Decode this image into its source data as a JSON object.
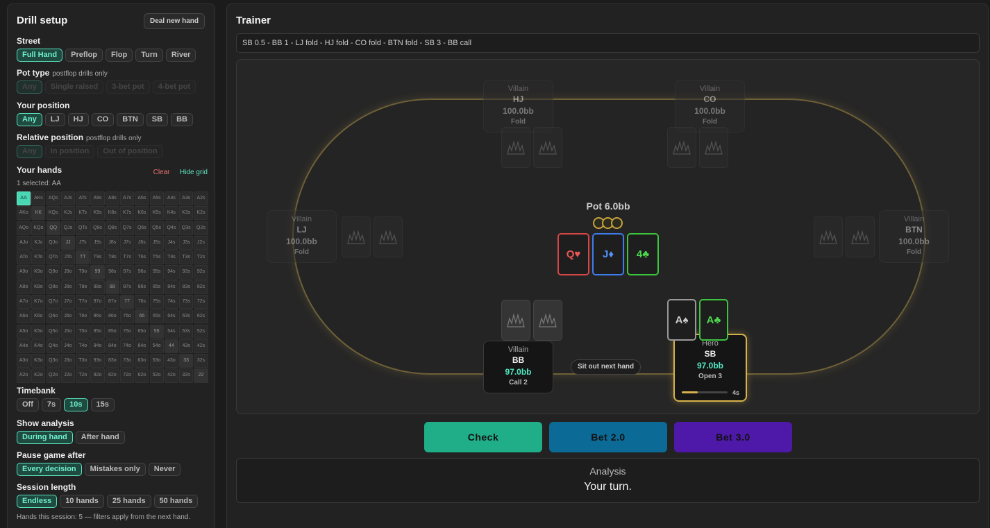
{
  "sidebar": {
    "title": "Drill setup",
    "deal_button": "Deal new hand",
    "street": {
      "label": "Street",
      "options": [
        "Full Hand",
        "Preflop",
        "Flop",
        "Turn",
        "River"
      ],
      "selected": "Full Hand"
    },
    "pot_type": {
      "label": "Pot type",
      "note": "postflop drills only",
      "options": [
        "Any",
        "Single raised",
        "3-bet pot",
        "4-bet pot"
      ],
      "selected": "Any"
    },
    "your_position": {
      "label": "Your position",
      "options": [
        "Any",
        "LJ",
        "HJ",
        "CO",
        "BTN",
        "SB",
        "BB"
      ],
      "selected": "Any"
    },
    "relative_position": {
      "label": "Relative position",
      "note": "postflop drills only",
      "options": [
        "Any",
        "In position",
        "Out of position"
      ],
      "selected": "Any"
    },
    "hands": {
      "label": "Your hands",
      "clear": "Clear",
      "hide_grid": "Hide grid",
      "selected_note": "1 selected: AA",
      "grid": [
        [
          "AA",
          "AKs",
          "AQs",
          "AJs",
          "ATs",
          "A9s",
          "A8s",
          "A7s",
          "A6s",
          "A5s",
          "A4s",
          "A3s",
          "A2s"
        ],
        [
          "AKo",
          "KK",
          "KQs",
          "KJs",
          "KTs",
          "K9s",
          "K8s",
          "K7s",
          "K6s",
          "K5s",
          "K4s",
          "K3s",
          "K2s"
        ],
        [
          "AQo",
          "KQo",
          "QQ",
          "QJs",
          "QTs",
          "Q9s",
          "Q8s",
          "Q7s",
          "Q6s",
          "Q5s",
          "Q4s",
          "Q3s",
          "Q2s"
        ],
        [
          "AJo",
          "KJo",
          "QJo",
          "JJ",
          "JTs",
          "J9s",
          "J8s",
          "J7s",
          "J6s",
          "J5s",
          "J4s",
          "J3s",
          "J2s"
        ],
        [
          "ATo",
          "KTo",
          "QTo",
          "JTo",
          "TT",
          "T9s",
          "T8s",
          "T7s",
          "T6s",
          "T5s",
          "T4s",
          "T3s",
          "T2s"
        ],
        [
          "A9o",
          "K9o",
          "Q9o",
          "J9o",
          "T9o",
          "99",
          "98s",
          "97s",
          "96s",
          "95s",
          "94s",
          "93s",
          "92s"
        ],
        [
          "A8o",
          "K8o",
          "Q8o",
          "J8o",
          "T8o",
          "98o",
          "88",
          "87s",
          "86s",
          "85s",
          "84s",
          "83s",
          "82s"
        ],
        [
          "A7o",
          "K7o",
          "Q7o",
          "J7o",
          "T7o",
          "97o",
          "87o",
          "77",
          "76s",
          "75s",
          "74s",
          "73s",
          "72s"
        ],
        [
          "A6o",
          "K6o",
          "Q6o",
          "J6o",
          "T6o",
          "96o",
          "86o",
          "76o",
          "66",
          "65s",
          "64s",
          "63s",
          "62s"
        ],
        [
          "A5o",
          "K5o",
          "Q5o",
          "J5o",
          "T5o",
          "95o",
          "85o",
          "75o",
          "65o",
          "55",
          "54s",
          "53s",
          "52s"
        ],
        [
          "A4o",
          "K4o",
          "Q4o",
          "J4o",
          "T4o",
          "94o",
          "84o",
          "74o",
          "64o",
          "54o",
          "44",
          "43s",
          "42s"
        ],
        [
          "A3o",
          "K3o",
          "Q3o",
          "J3o",
          "T3o",
          "93o",
          "83o",
          "73o",
          "63o",
          "53o",
          "43o",
          "33",
          "32s"
        ],
        [
          "A2o",
          "K2o",
          "Q2o",
          "J2o",
          "T2o",
          "92o",
          "82o",
          "72o",
          "62o",
          "52o",
          "42o",
          "32o",
          "22"
        ]
      ],
      "selected": [
        "AA"
      ]
    },
    "timebank": {
      "label": "Timebank",
      "options": [
        "Off",
        "7s",
        "10s",
        "15s"
      ],
      "selected": "10s"
    },
    "show_analysis": {
      "label": "Show analysis",
      "options": [
        "During hand",
        "After hand"
      ],
      "selected": "During hand"
    },
    "pause_game": {
      "label": "Pause game after",
      "options": [
        "Every decision",
        "Mistakes only",
        "Never"
      ],
      "selected": "Every decision"
    },
    "session_length": {
      "label": "Session length",
      "options": [
        "Endless",
        "10 hands",
        "25 hands",
        "50 hands"
      ],
      "selected": "Endless"
    },
    "session_note": "Hands this session: 5 — filters apply from the next hand."
  },
  "trainer": {
    "title": "Trainer",
    "history": "SB 0.5 - BB 1 - LJ fold - HJ fold - CO fold - BTN fold - SB 3 - BB call",
    "pot": "Pot 6.0bb",
    "board": [
      {
        "rank": "Q",
        "suit": "♥",
        "color": "#ee5555"
      },
      {
        "rank": "J",
        "suit": "♦",
        "color": "#5592ff"
      },
      {
        "rank": "4",
        "suit": "♣",
        "color": "#4dd84d"
      }
    ],
    "hero_cards": [
      {
        "rank": "A",
        "suit": "♠",
        "color": "#cccccc"
      },
      {
        "rank": "A",
        "suit": "♣",
        "color": "#4dd84d"
      }
    ],
    "seats": {
      "hj": {
        "role": "Villain",
        "pos": "HJ",
        "stack": "100.0bb",
        "action": "Fold"
      },
      "co": {
        "role": "Villain",
        "pos": "CO",
        "stack": "100.0bb",
        "action": "Fold"
      },
      "lj": {
        "role": "Villain",
        "pos": "LJ",
        "stack": "100.0bb",
        "action": "Fold"
      },
      "btn": {
        "role": "Villain",
        "pos": "BTN",
        "stack": "100.0bb",
        "action": "Fold"
      },
      "bb": {
        "role": "Villain",
        "pos": "BB",
        "stack": "97.0bb",
        "action": "Call 2"
      },
      "sb": {
        "role": "Hero",
        "pos": "SB",
        "stack": "97.0bb",
        "action": "Open 3",
        "timer": "4s",
        "timer_fraction": 0.35
      }
    },
    "sit_out": "Sit out next hand",
    "actions": {
      "check": "Check",
      "bet_small": "Bet 2.0",
      "bet_large": "Bet 3.0"
    },
    "analysis": {
      "title": "Analysis",
      "text": "Your turn."
    }
  },
  "colors": {
    "accent": "#59e3bf",
    "hero_border": "#d8b14d",
    "check": "#1fae88",
    "bet_small": "#0b6b96",
    "bet_large": "#4e18a8"
  }
}
